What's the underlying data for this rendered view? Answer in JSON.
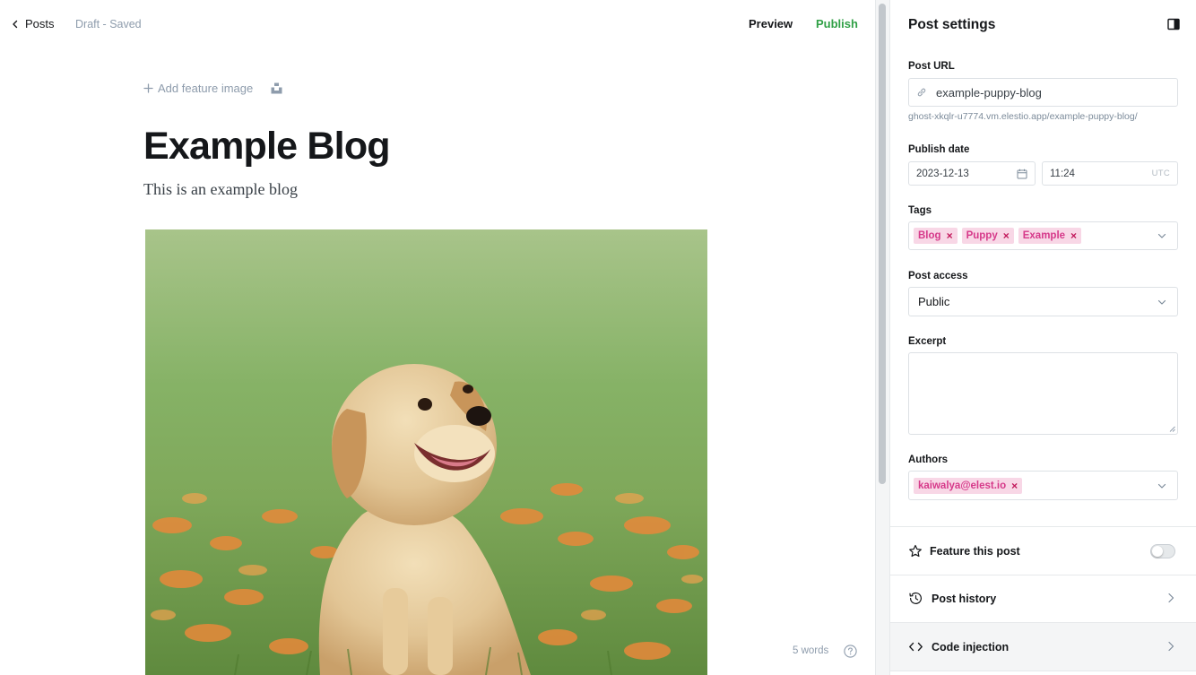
{
  "topbar": {
    "back_label": "Posts",
    "status": "Draft - Saved",
    "preview_label": "Preview",
    "publish_label": "Publish"
  },
  "editor": {
    "add_feature_image_label": "Add feature image",
    "title": "Example Blog",
    "excerpt": "This is an example blog",
    "word_count": "5 words"
  },
  "settings": {
    "title": "Post settings",
    "post_url": {
      "label": "Post URL",
      "value": "example-puppy-blog",
      "hint": "ghost-xkqlr-u7774.vm.elestio.app/example-puppy-blog/"
    },
    "publish_date": {
      "label": "Publish date",
      "date": "2023-12-13",
      "time": "11:24",
      "timezone": "UTC"
    },
    "tags": {
      "label": "Tags",
      "items": [
        "Blog",
        "Puppy",
        "Example"
      ]
    },
    "post_access": {
      "label": "Post access",
      "value": "Public"
    },
    "excerpt": {
      "label": "Excerpt",
      "value": ""
    },
    "authors": {
      "label": "Authors",
      "items": [
        "kaiwalya@elest.io"
      ]
    },
    "feature_post": {
      "label": "Feature this post",
      "enabled": false
    },
    "post_history_label": "Post history",
    "code_injection_label": "Code injection"
  },
  "colors": {
    "publish": "#30a046",
    "tag_bg": "#f8d7e6",
    "tag_text": "#d6398a",
    "muted": "#8e9cac"
  }
}
